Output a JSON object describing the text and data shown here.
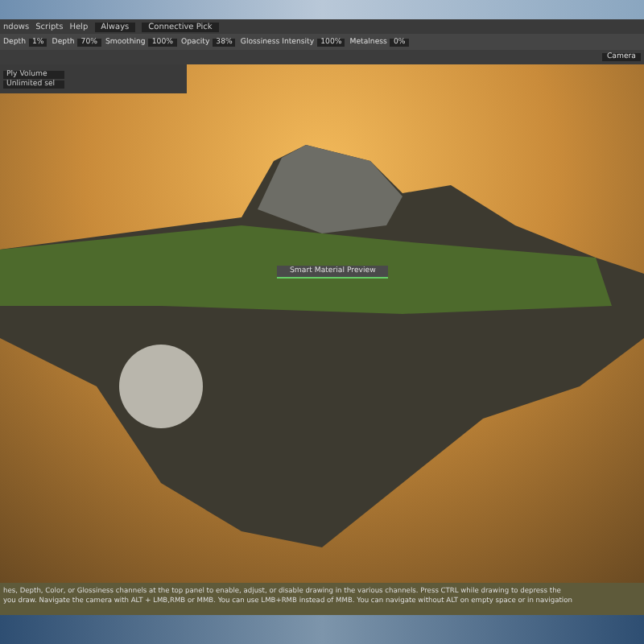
{
  "menu": {
    "items": [
      "ndows",
      "Scripts",
      "Help"
    ],
    "mode": "Always",
    "pick": "Connective Pick"
  },
  "toolbar": {
    "params": [
      {
        "label": "Depth",
        "value": "1%"
      },
      {
        "label": "Depth",
        "value": "70%"
      },
      {
        "label": "Smoothing",
        "value": "100%"
      },
      {
        "label": "Opacity",
        "value": "38%"
      },
      {
        "label": "Glossiness Intensity",
        "value": "100%"
      },
      {
        "label": "Metalness",
        "value": "0%"
      }
    ]
  },
  "view": {
    "camera": "Camera"
  },
  "tool_panel": {
    "fields": [
      "Ply Volume",
      "Unlimited sel"
    ]
  },
  "preview_label": "Smart Material Preview",
  "hint": [
    "hes, Depth, Color, or Glossiness channels at the top panel to enable, adjust, or disable drawing in the various channels. Press CTRL while drawing to depress the",
    "you draw. Navigate the camera with ALT + LMB,RMB or MMB. You can use LMB+RMB instead of MMB. You can navigate without ALT on empty space or in navigation"
  ]
}
